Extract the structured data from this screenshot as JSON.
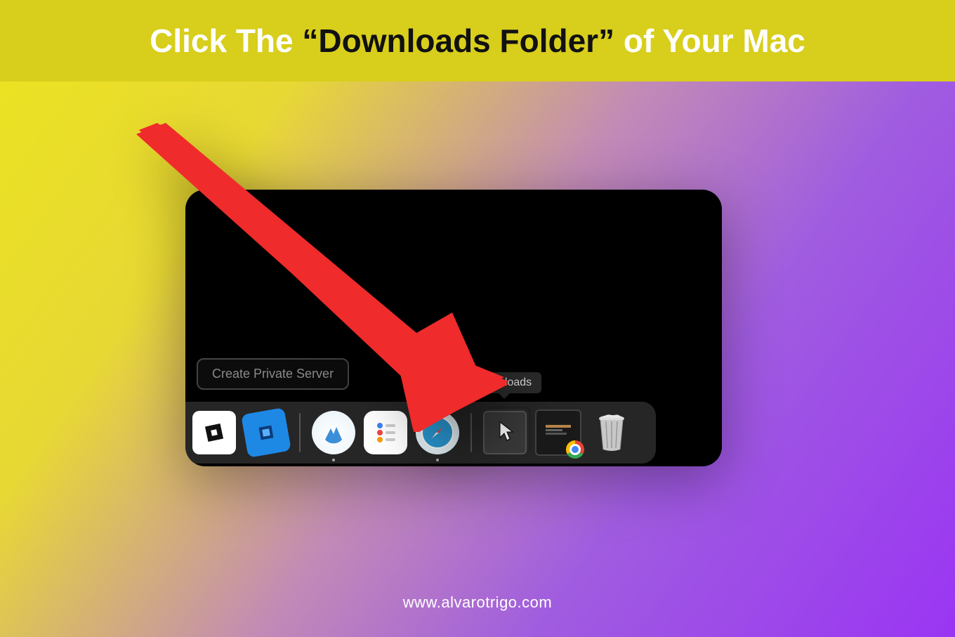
{
  "header": {
    "prefix": "Click The ",
    "emphasis": "“Downloads Folder”",
    "suffix": " of Your Mac"
  },
  "screenshot": {
    "button_label": "Create Private Server",
    "tooltip_label": "Downloads",
    "dock_items": [
      {
        "name": "roblox-app-icon",
        "label": "Roblox"
      },
      {
        "name": "roblox-studio-icon",
        "label": "Roblox Studio"
      },
      {
        "name": "nordvpn-icon",
        "label": "NordVPN"
      },
      {
        "name": "reminders-icon",
        "label": "Reminders"
      },
      {
        "name": "safari-icon",
        "label": "Safari"
      },
      {
        "name": "downloads-stack-icon",
        "label": "Downloads"
      },
      {
        "name": "folder-stack-icon",
        "label": "Folder"
      },
      {
        "name": "trash-icon",
        "label": "Trash"
      }
    ]
  },
  "footer": {
    "url": "www.alvarotrigo.com"
  },
  "colors": {
    "banner": "#d8ce1c",
    "arrow": "#ef2b2b"
  }
}
